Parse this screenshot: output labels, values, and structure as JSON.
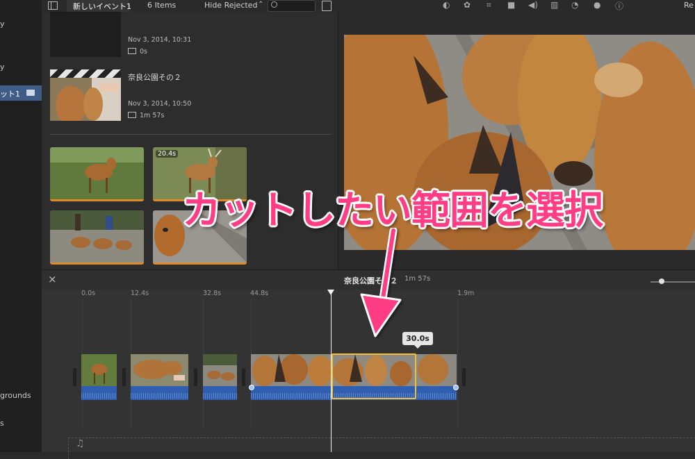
{
  "sidebar": {
    "items": [
      {
        "label": "y"
      },
      {
        "label": "y"
      },
      {
        "label": "ット1"
      },
      {
        "label": "grounds"
      },
      {
        "label": "s"
      }
    ]
  },
  "toolbar": {
    "event_tab_label": "新しいイベント1",
    "item_count": "6 Items",
    "filter_label": "Hide Rejected",
    "reset_label": "Re",
    "search_placeholder": ""
  },
  "browser": {
    "events": [
      {
        "title": "",
        "date": "Nov 3, 2014, 10:31",
        "duration": "0s"
      },
      {
        "title": "奈良公園その２",
        "date": "Nov 3, 2014, 10:50",
        "duration": "1m 57s"
      }
    ],
    "clips": [
      {
        "badge": ""
      },
      {
        "badge": "20.4s"
      },
      {
        "badge": ""
      },
      {
        "badge": ""
      }
    ]
  },
  "overlay": {
    "caption": "カットしたい範囲を選択"
  },
  "timeline": {
    "project_title": "奈良公園その２",
    "project_duration": "1m 57s",
    "ticks": [
      "0.0s",
      "12.4s",
      "32.8s",
      "44.8s",
      "1.9m"
    ],
    "selection_duration": "30.0s"
  },
  "icons": {
    "sidebar_toggle": "sidebar-toggle-icon",
    "search": "search-icon",
    "filmstrip": "filmstrip-icon",
    "close": "close-icon",
    "music": "music-note-icon"
  },
  "colors": {
    "selection": "#f4c033",
    "audio": "#2f5fae",
    "caption": "#ff3d84",
    "clip_underline": "#e08a2c",
    "sidebar_selected": "#3e5c86"
  }
}
